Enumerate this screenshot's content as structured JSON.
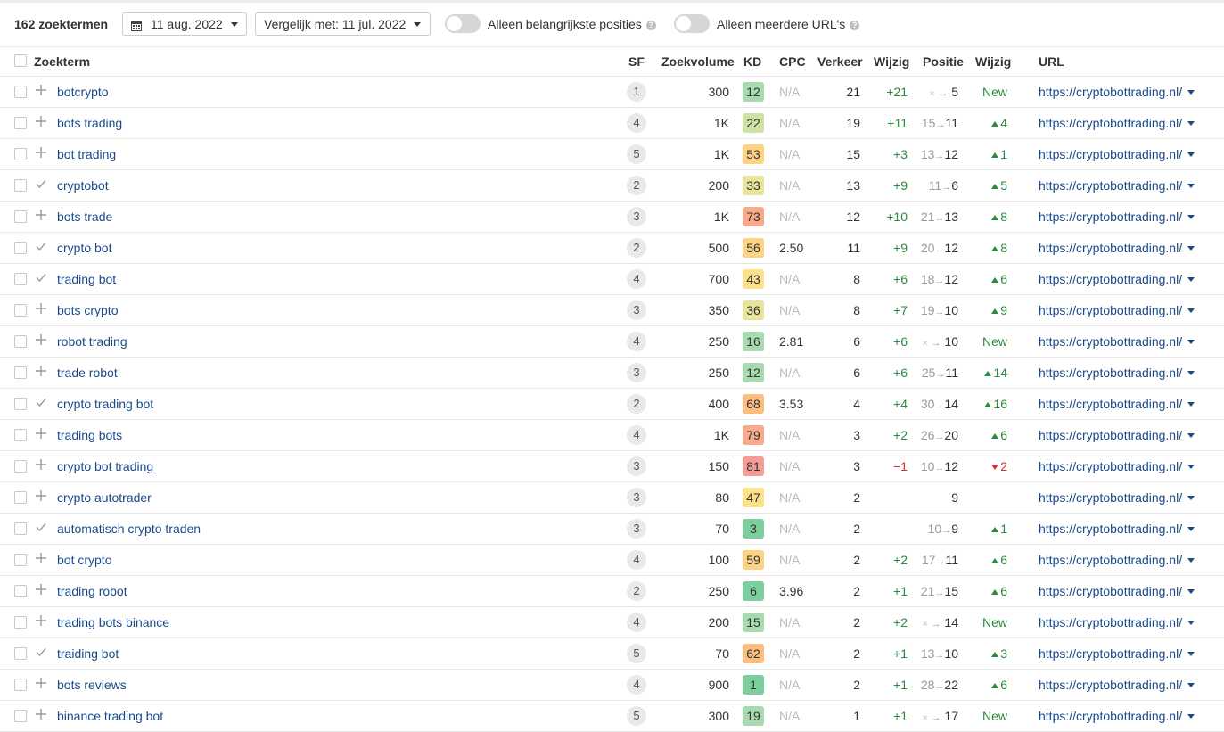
{
  "toolbar": {
    "count_label": "162 zoektermen",
    "date_label": "11 aug. 2022",
    "compare_label": "Vergelijk met: 11 jul. 2022",
    "toggle_top_positions": {
      "label": "Alleen belangrijkste posities",
      "on": false
    },
    "toggle_multiple_urls": {
      "label": "Alleen meerdere URL's",
      "on": false
    },
    "help_glyph": "?"
  },
  "columns": {
    "keyword": "Zoekterm",
    "sf": "SF",
    "volume": "Zoekvolume",
    "kd": "KD",
    "cpc": "CPC",
    "traffic": "Verkeer",
    "traffic_change": "Wijzig",
    "position": "Positie",
    "position_change": "Wijzig",
    "url": "URL"
  },
  "kd_colors": {
    "very_easy": "#7ccf9c",
    "easy": "#a8dab0",
    "low_medium": "#cfe2a4",
    "medium_low": "#e8e59a",
    "medium": "#fde08a",
    "medium_high": "#fdd283",
    "hard": "#fdbd7e",
    "very_hard": "#f8aa8a",
    "super_hard": "#f59c95"
  },
  "rows": [
    {
      "keyword": "botcrypto",
      "action": "plus",
      "sf": "1",
      "volume": "300",
      "kd": "12",
      "cpc": "N/A",
      "traffic": "21",
      "traffic_change": "+21",
      "traffic_dir": "up",
      "pos_from": "",
      "pos_to": "5",
      "pos_change": "New",
      "pos_dir": "new",
      "url": "https://cryptobottrading.nl/"
    },
    {
      "keyword": "bots trading",
      "action": "plus",
      "sf": "4",
      "volume": "1K",
      "kd": "22",
      "cpc": "N/A",
      "traffic": "19",
      "traffic_change": "+11",
      "traffic_dir": "up",
      "pos_from": "15",
      "pos_to": "11",
      "pos_change": "4",
      "pos_dir": "up",
      "url": "https://cryptobottrading.nl/"
    },
    {
      "keyword": "bot trading",
      "action": "plus",
      "sf": "5",
      "volume": "1K",
      "kd": "53",
      "cpc": "N/A",
      "traffic": "15",
      "traffic_change": "+3",
      "traffic_dir": "up",
      "pos_from": "13",
      "pos_to": "12",
      "pos_change": "1",
      "pos_dir": "up",
      "url": "https://cryptobottrading.nl/"
    },
    {
      "keyword": "cryptobot",
      "action": "check",
      "sf": "2",
      "volume": "200",
      "kd": "33",
      "cpc": "N/A",
      "traffic": "13",
      "traffic_change": "+9",
      "traffic_dir": "up",
      "pos_from": "11",
      "pos_to": "6",
      "pos_change": "5",
      "pos_dir": "up",
      "url": "https://cryptobottrading.nl/"
    },
    {
      "keyword": "bots trade",
      "action": "plus",
      "sf": "3",
      "volume": "1K",
      "kd": "73",
      "cpc": "N/A",
      "traffic": "12",
      "traffic_change": "+10",
      "traffic_dir": "up",
      "pos_from": "21",
      "pos_to": "13",
      "pos_change": "8",
      "pos_dir": "up",
      "url": "https://cryptobottrading.nl/"
    },
    {
      "keyword": "crypto bot",
      "action": "check",
      "sf": "2",
      "volume": "500",
      "kd": "56",
      "cpc": "2.50",
      "traffic": "11",
      "traffic_change": "+9",
      "traffic_dir": "up",
      "pos_from": "20",
      "pos_to": "12",
      "pos_change": "8",
      "pos_dir": "up",
      "url": "https://cryptobottrading.nl/"
    },
    {
      "keyword": "trading bot",
      "action": "check",
      "sf": "4",
      "volume": "700",
      "kd": "43",
      "cpc": "N/A",
      "traffic": "8",
      "traffic_change": "+6",
      "traffic_dir": "up",
      "pos_from": "18",
      "pos_to": "12",
      "pos_change": "6",
      "pos_dir": "up",
      "url": "https://cryptobottrading.nl/"
    },
    {
      "keyword": "bots crypto",
      "action": "plus",
      "sf": "3",
      "volume": "350",
      "kd": "36",
      "cpc": "N/A",
      "traffic": "8",
      "traffic_change": "+7",
      "traffic_dir": "up",
      "pos_from": "19",
      "pos_to": "10",
      "pos_change": "9",
      "pos_dir": "up",
      "url": "https://cryptobottrading.nl/"
    },
    {
      "keyword": "robot trading",
      "action": "plus",
      "sf": "4",
      "volume": "250",
      "kd": "16",
      "cpc": "2.81",
      "traffic": "6",
      "traffic_change": "+6",
      "traffic_dir": "up",
      "pos_from": "",
      "pos_to": "10",
      "pos_change": "New",
      "pos_dir": "new",
      "url": "https://cryptobottrading.nl/"
    },
    {
      "keyword": "trade robot",
      "action": "plus",
      "sf": "3",
      "volume": "250",
      "kd": "12",
      "cpc": "N/A",
      "traffic": "6",
      "traffic_change": "+6",
      "traffic_dir": "up",
      "pos_from": "25",
      "pos_to": "11",
      "pos_change": "14",
      "pos_dir": "up",
      "url": "https://cryptobottrading.nl/"
    },
    {
      "keyword": "crypto trading bot",
      "action": "check",
      "sf": "2",
      "volume": "400",
      "kd": "68",
      "cpc": "3.53",
      "traffic": "4",
      "traffic_change": "+4",
      "traffic_dir": "up",
      "pos_from": "30",
      "pos_to": "14",
      "pos_change": "16",
      "pos_dir": "up",
      "url": "https://cryptobottrading.nl/"
    },
    {
      "keyword": "trading bots",
      "action": "plus",
      "sf": "4",
      "volume": "1K",
      "kd": "79",
      "cpc": "N/A",
      "traffic": "3",
      "traffic_change": "+2",
      "traffic_dir": "up",
      "pos_from": "26",
      "pos_to": "20",
      "pos_change": "6",
      "pos_dir": "up",
      "url": "https://cryptobottrading.nl/"
    },
    {
      "keyword": "crypto bot trading",
      "action": "plus",
      "sf": "3",
      "volume": "150",
      "kd": "81",
      "cpc": "N/A",
      "traffic": "3",
      "traffic_change": "−1",
      "traffic_dir": "down",
      "pos_from": "10",
      "pos_to": "12",
      "pos_change": "2",
      "pos_dir": "down",
      "url": "https://cryptobottrading.nl/"
    },
    {
      "keyword": "crypto autotrader",
      "action": "plus",
      "sf": "3",
      "volume": "80",
      "kd": "47",
      "cpc": "N/A",
      "traffic": "2",
      "traffic_change": "",
      "traffic_dir": "none",
      "pos_from": null,
      "pos_to": "9",
      "pos_change": "",
      "pos_dir": "none",
      "url": "https://cryptobottrading.nl/"
    },
    {
      "keyword": "automatisch crypto traden",
      "action": "check",
      "sf": "3",
      "volume": "70",
      "kd": "3",
      "cpc": "N/A",
      "traffic": "2",
      "traffic_change": "",
      "traffic_dir": "none",
      "pos_from": "10",
      "pos_to": "9",
      "pos_change": "1",
      "pos_dir": "up",
      "url": "https://cryptobottrading.nl/"
    },
    {
      "keyword": "bot crypto",
      "action": "plus",
      "sf": "4",
      "volume": "100",
      "kd": "59",
      "cpc": "N/A",
      "traffic": "2",
      "traffic_change": "+2",
      "traffic_dir": "up",
      "pos_from": "17",
      "pos_to": "11",
      "pos_change": "6",
      "pos_dir": "up",
      "url": "https://cryptobottrading.nl/"
    },
    {
      "keyword": "trading robot",
      "action": "plus",
      "sf": "2",
      "volume": "250",
      "kd": "6",
      "cpc": "3.96",
      "traffic": "2",
      "traffic_change": "+1",
      "traffic_dir": "up",
      "pos_from": "21",
      "pos_to": "15",
      "pos_change": "6",
      "pos_dir": "up",
      "url": "https://cryptobottrading.nl/"
    },
    {
      "keyword": "trading bots binance",
      "action": "plus",
      "sf": "4",
      "volume": "200",
      "kd": "15",
      "cpc": "N/A",
      "traffic": "2",
      "traffic_change": "+2",
      "traffic_dir": "up",
      "pos_from": "",
      "pos_to": "14",
      "pos_change": "New",
      "pos_dir": "new",
      "url": "https://cryptobottrading.nl/"
    },
    {
      "keyword": "traiding bot",
      "action": "check",
      "sf": "5",
      "volume": "70",
      "kd": "62",
      "cpc": "N/A",
      "traffic": "2",
      "traffic_change": "+1",
      "traffic_dir": "up",
      "pos_from": "13",
      "pos_to": "10",
      "pos_change": "3",
      "pos_dir": "up",
      "url": "https://cryptobottrading.nl/"
    },
    {
      "keyword": "bots reviews",
      "action": "plus",
      "sf": "4",
      "volume": "900",
      "kd": "1",
      "cpc": "N/A",
      "traffic": "2",
      "traffic_change": "+1",
      "traffic_dir": "up",
      "pos_from": "28",
      "pos_to": "22",
      "pos_change": "6",
      "pos_dir": "up",
      "url": "https://cryptobottrading.nl/"
    },
    {
      "keyword": "binance trading bot",
      "action": "plus",
      "sf": "5",
      "volume": "300",
      "kd": "19",
      "cpc": "N/A",
      "traffic": "1",
      "traffic_change": "+1",
      "traffic_dir": "up",
      "pos_from": "",
      "pos_to": "17",
      "pos_change": "New",
      "pos_dir": "new",
      "url": "https://cryptobottrading.nl/"
    }
  ]
}
